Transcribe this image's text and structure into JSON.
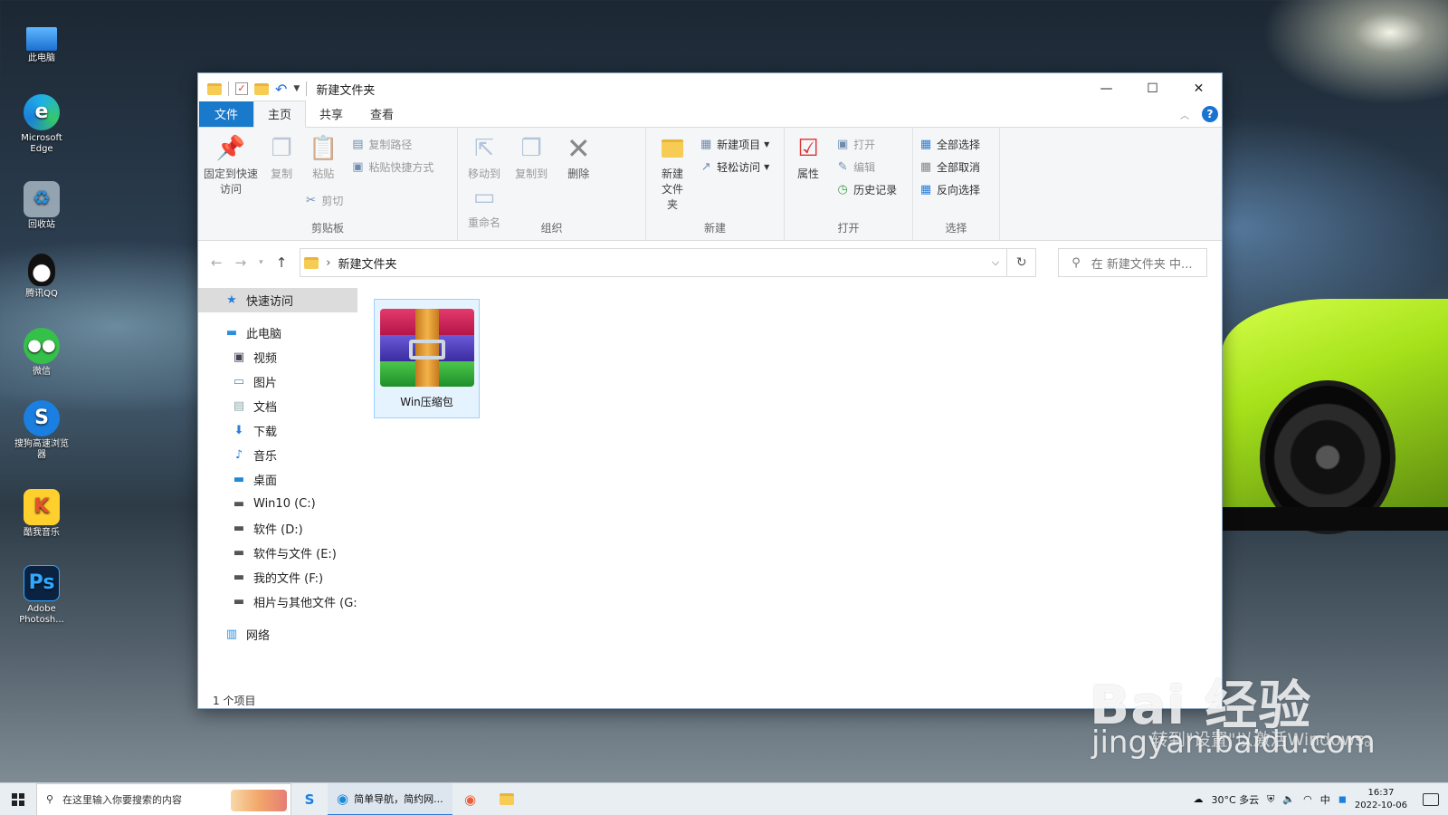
{
  "desktop": {
    "icons": [
      {
        "label": "此电脑",
        "icon": "this-pc-icon"
      },
      {
        "label": "Microsoft Edge",
        "icon": "edge-icon"
      },
      {
        "label": "回收站",
        "icon": "recycle-bin-icon"
      },
      {
        "label": "腾讯QQ",
        "icon": "qq-icon"
      },
      {
        "label": "微信",
        "icon": "wechat-icon"
      },
      {
        "label": "搜狗高速浏览器",
        "icon": "sogou-browser-icon"
      },
      {
        "label": "酷我音乐",
        "icon": "kuwo-music-icon"
      },
      {
        "label": "Adobe Photosh...",
        "icon": "photoshop-icon"
      }
    ]
  },
  "window": {
    "title": "新建文件夹",
    "controls": {
      "minimize": "—",
      "maximize": "☐",
      "close": "✕"
    },
    "tabs": {
      "file": "文件",
      "home": "主页",
      "share": "共享",
      "view": "查看"
    },
    "ribbon": {
      "clipboard": {
        "label": "剪贴板",
        "pin": "固定到快速访问",
        "copy": "复制",
        "paste": "粘贴",
        "copy_path": "复制路径",
        "paste_shortcut": "粘贴快捷方式",
        "cut": "剪切"
      },
      "organize": {
        "label": "组织",
        "move_to": "移动到",
        "copy_to": "复制到",
        "delete": "删除",
        "rename": "重命名"
      },
      "new": {
        "label": "新建",
        "new_folder": "新建文件夹",
        "new_item": "新建项目",
        "easy_access": "轻松访问"
      },
      "open": {
        "label": "打开",
        "properties": "属性",
        "open": "打开",
        "edit": "编辑",
        "history": "历史记录"
      },
      "select": {
        "label": "选择",
        "select_all": "全部选择",
        "select_none": "全部取消",
        "invert": "反向选择"
      }
    },
    "address": {
      "path": "新建文件夹",
      "search_placeholder": "在 新建文件夹 中..."
    },
    "nav": {
      "quick_access": "快速访问",
      "this_pc": "此电脑",
      "items": [
        "视频",
        "图片",
        "文档",
        "下载",
        "音乐",
        "桌面",
        "Win10 (C:)",
        "软件 (D:)",
        "软件与文件 (E:)",
        "我的文件 (F:)",
        "相片与其他文件 (G:"
      ],
      "network": "网络"
    },
    "files": [
      {
        "name": "Win压缩包",
        "icon": "winrar-icon"
      }
    ],
    "status": "1 个项目"
  },
  "watermark": {
    "brand": "Bai  经验",
    "url": "jingyan.baidu.com",
    "activate": "转到\"设置\"以激活Windows。"
  },
  "taskbar": {
    "search_placeholder": "在这里输入你要搜索的内容",
    "app_label": "简单导航，简约网...",
    "weather": "30°C 多云",
    "time": "16:37",
    "date": "2022-10-06"
  }
}
